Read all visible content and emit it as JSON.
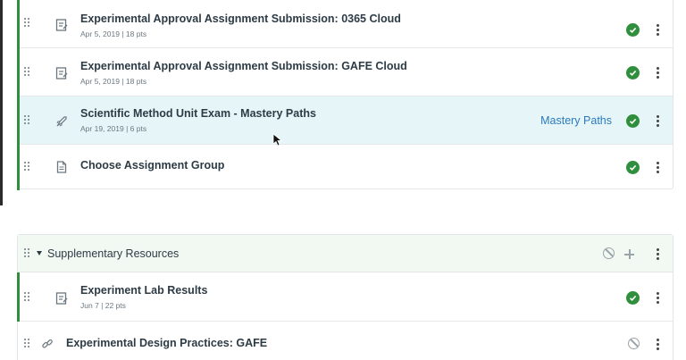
{
  "assignment_group": {
    "items": [
      {
        "title": "Experimental Approval Assignment Submission: 0365 Cloud",
        "date": "Apr 5, 2019",
        "points": "18 pts",
        "icon": "assignment-icon",
        "completed": true
      },
      {
        "title": "Experimental Approval Assignment Submission: GAFE Cloud",
        "date": "Apr 5, 2019",
        "points": "18 pts",
        "icon": "assignment-icon",
        "completed": true
      },
      {
        "title": "Scientific Method Unit Exam - Mastery Paths",
        "date": "Apr 19, 2019",
        "points": "6 pts",
        "icon": "quiz-rocket-icon",
        "completed": true,
        "link_label": "Mastery Paths"
      },
      {
        "title": "Choose Assignment Group",
        "icon": "page-icon",
        "completed": true
      }
    ]
  },
  "supplementary_module": {
    "title": "Supplementary Resources",
    "items": [
      {
        "title": "Experiment Lab Results",
        "date": "Jun 7",
        "points": "22 pts",
        "icon": "assignment-icon",
        "completed": true
      },
      {
        "title": "Experimental Design Practices: GAFE",
        "icon": "link-icon",
        "completed": false
      }
    ]
  },
  "meta_separator": "|",
  "colors": {
    "complete": "#2f8f3d",
    "accent_link": "#2b7abc",
    "highlight_row": "#e6f6f8",
    "module_header": "#f2f9f3"
  }
}
